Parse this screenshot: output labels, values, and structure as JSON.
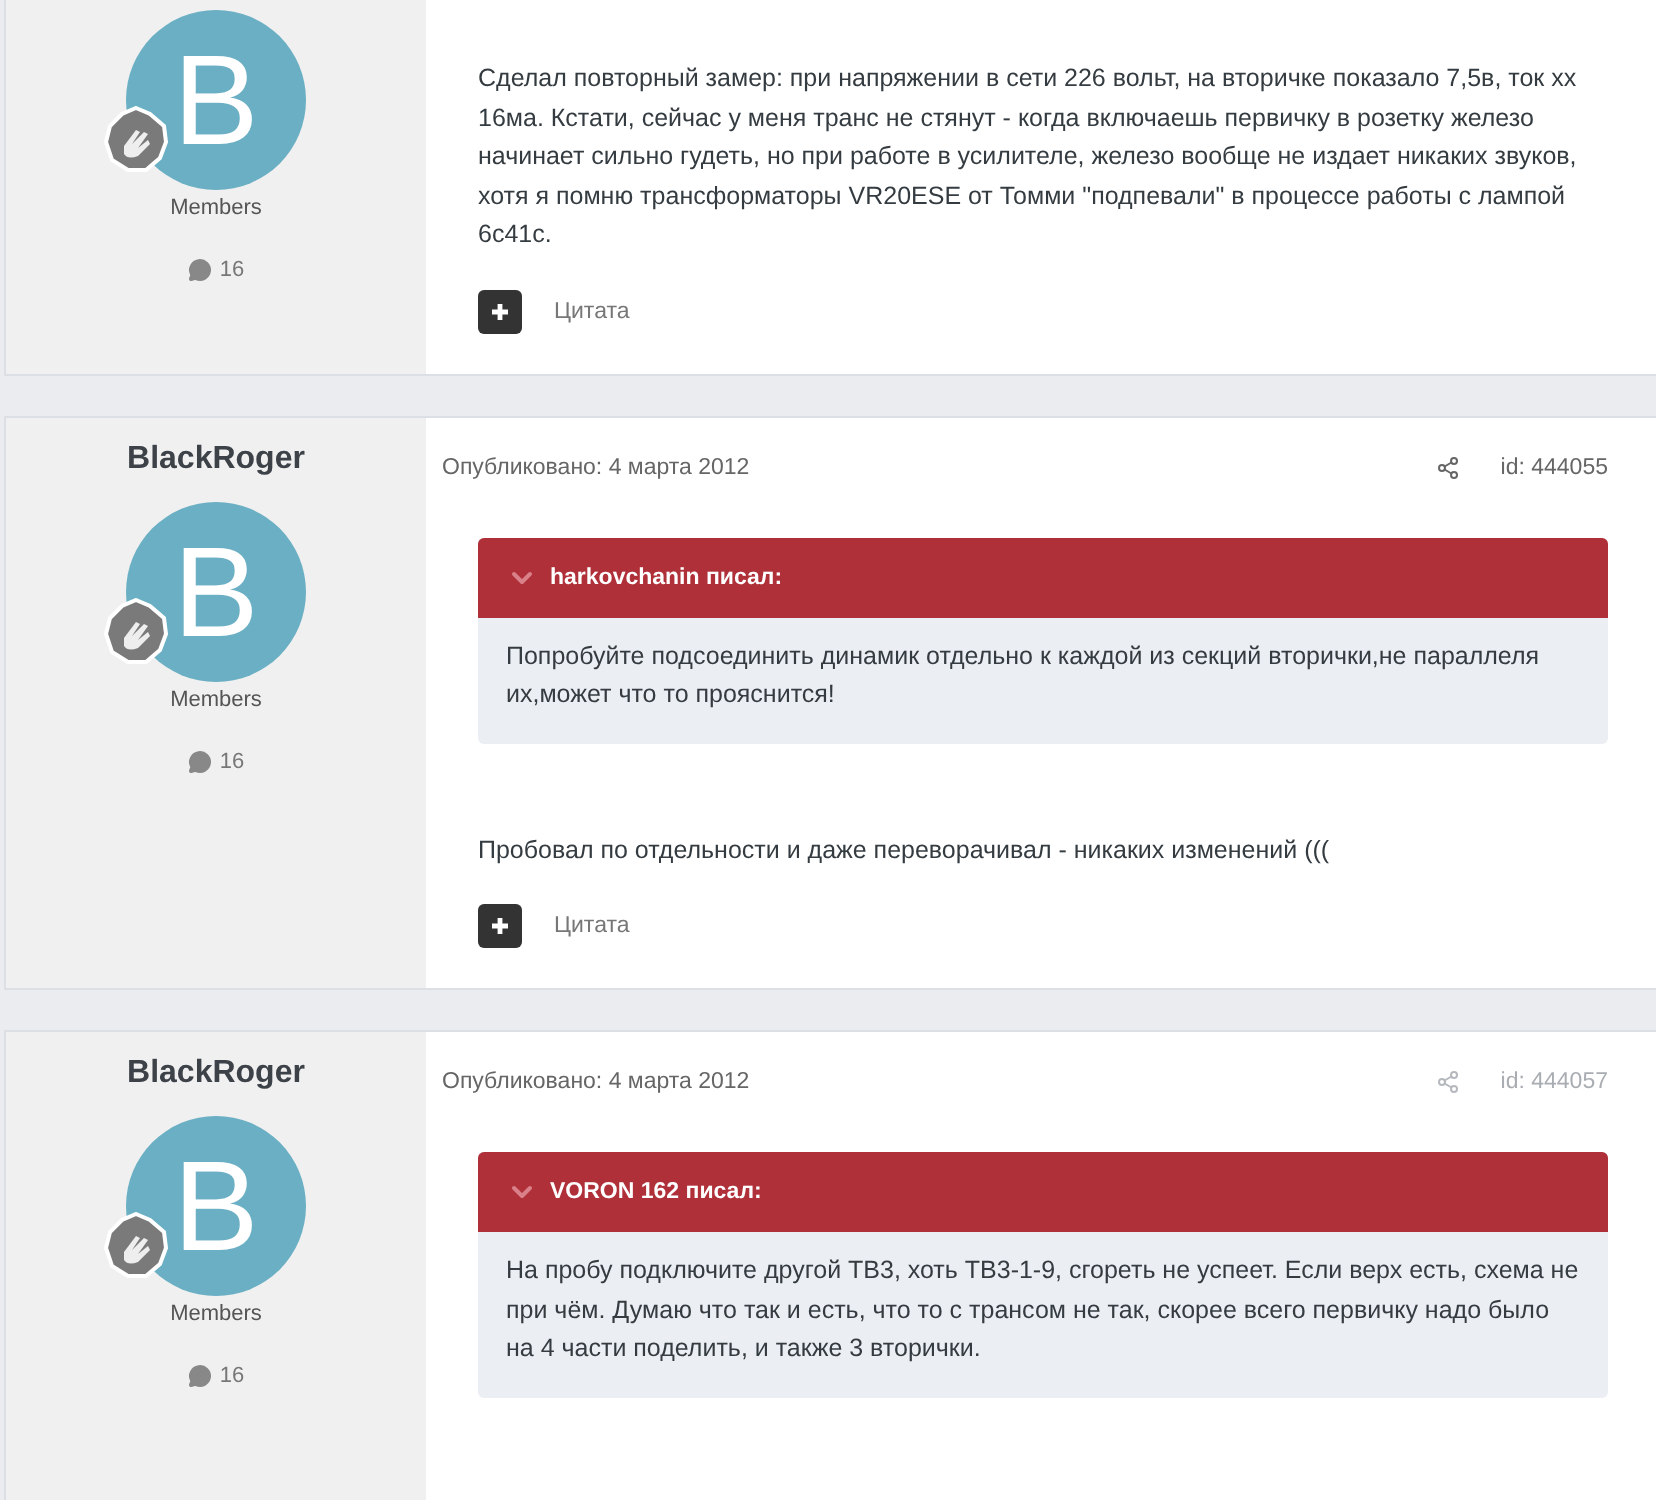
{
  "posts": [
    {
      "avatar_letter": "B",
      "group": "Members",
      "post_count": "16",
      "body": "Сделал повторный замер: при напряжении в сети 226 вольт, на вторичке показало 7,5в, ток хх 16ма. Кстати, сейчас у меня транс не стянут - когда включаешь первичку в розетку железо начинает сильно гудеть, но при работе в усилителе, железо вообще не издает никаких звуков, хотя я помню трансформаторы VR20ESE от Томми \"подпевали\" в процессе работы с лампой 6с41с.",
      "quote_button": "Цитата"
    },
    {
      "author": "BlackRoger",
      "avatar_letter": "B",
      "group": "Members",
      "post_count": "16",
      "published": "Опубликовано: 4 марта 2012",
      "post_id": "id: 444055",
      "meta_dimmed": false,
      "quote": {
        "header": "harkovchanin писал:",
        "text": "Попробуйте подсоединить динамик отдельно к каждой из секций вторички,не параллеля их,может что то прояснится!"
      },
      "body": "Пробовал по отдельности и даже переворачивал - никаких изменений (((",
      "quote_button": "Цитата"
    },
    {
      "author": "BlackRoger",
      "avatar_letter": "B",
      "group": "Members",
      "post_count": "16",
      "published": "Опубликовано: 4 марта 2012",
      "post_id": "id: 444057",
      "meta_dimmed": true,
      "quote": {
        "header": "VORON 162 писал:",
        "text": "На пробу подключите другой ТВ3, хоть ТВ3-1-9, сгореть не успеет. Если верх есть, схема не при чём. Думаю что так и есть, что то с трансом не так, скорее всего первичку надо было на 4 части поделить, и также 3 вторички."
      }
    }
  ]
}
